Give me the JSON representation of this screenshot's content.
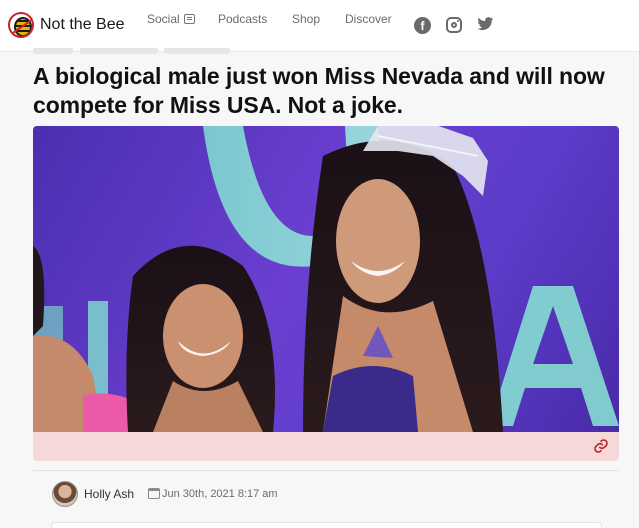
{
  "header": {
    "brand": "Not the Bee",
    "nav": [
      {
        "label": "Social"
      },
      {
        "label": "Podcasts"
      },
      {
        "label": "Shop"
      },
      {
        "label": "Discover"
      }
    ],
    "social_icons": [
      "facebook-icon",
      "instagram-icon",
      "twitter-icon"
    ]
  },
  "article": {
    "headline": "A biological male just won Miss Nevada and will now compete for Miss USA. Not a joke.",
    "author": "Holly Ash",
    "date": "Jun 30th, 2021 8:17 am"
  },
  "colors": {
    "accent": "#c8242b",
    "photo_bar": "#f6d8d8",
    "photo_background": "#5b3bc6"
  },
  "icons": {
    "link": "link-icon",
    "calendar": "calendar-icon"
  }
}
